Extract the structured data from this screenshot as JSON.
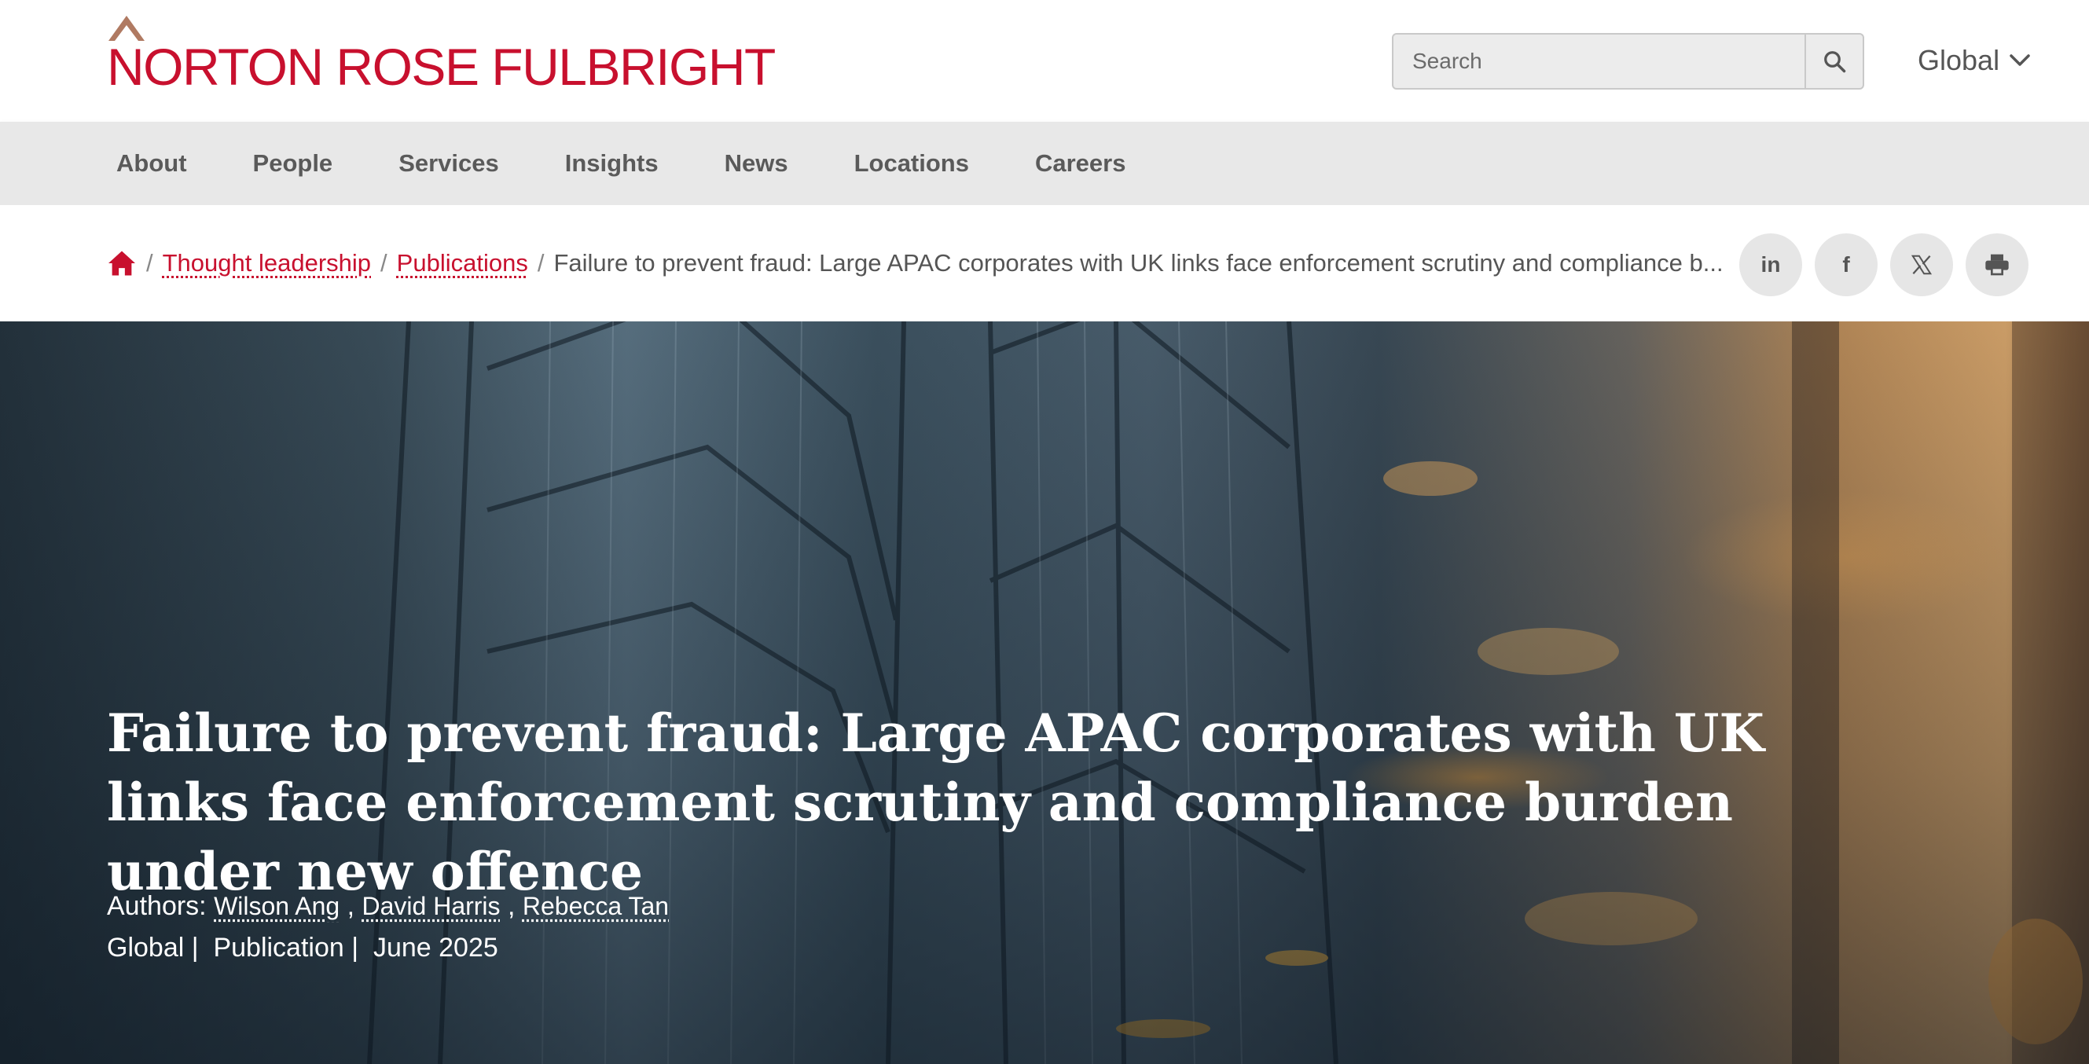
{
  "brand": {
    "name": "NORTON ROSE FULBRIGHT",
    "color": "#c8102e"
  },
  "search": {
    "placeholder": "Search",
    "value": ""
  },
  "region": {
    "label": "Global"
  },
  "nav": {
    "items": [
      "About",
      "People",
      "Services",
      "Insights",
      "News",
      "Locations",
      "Careers"
    ]
  },
  "breadcrumb": {
    "items": [
      "Thought leadership",
      "Publications"
    ],
    "separator": "/",
    "current": "Failure to prevent fraud: Large APAC corporates with UK links face enforcement scrutiny and compliance b..."
  },
  "share": {
    "linkedin": "in",
    "facebook": "f",
    "x": "X",
    "print": "print-icon"
  },
  "hero": {
    "title": "Failure to prevent fraud: Large APAC corporates with UK links face enforcement scrutiny and compliance burden under new offence",
    "authors_label": "Authors:",
    "authors": [
      "Wilson Ang",
      "David Harris",
      "Rebecca Tan"
    ],
    "meta": [
      "Global",
      "Publication",
      "June 2025"
    ]
  }
}
